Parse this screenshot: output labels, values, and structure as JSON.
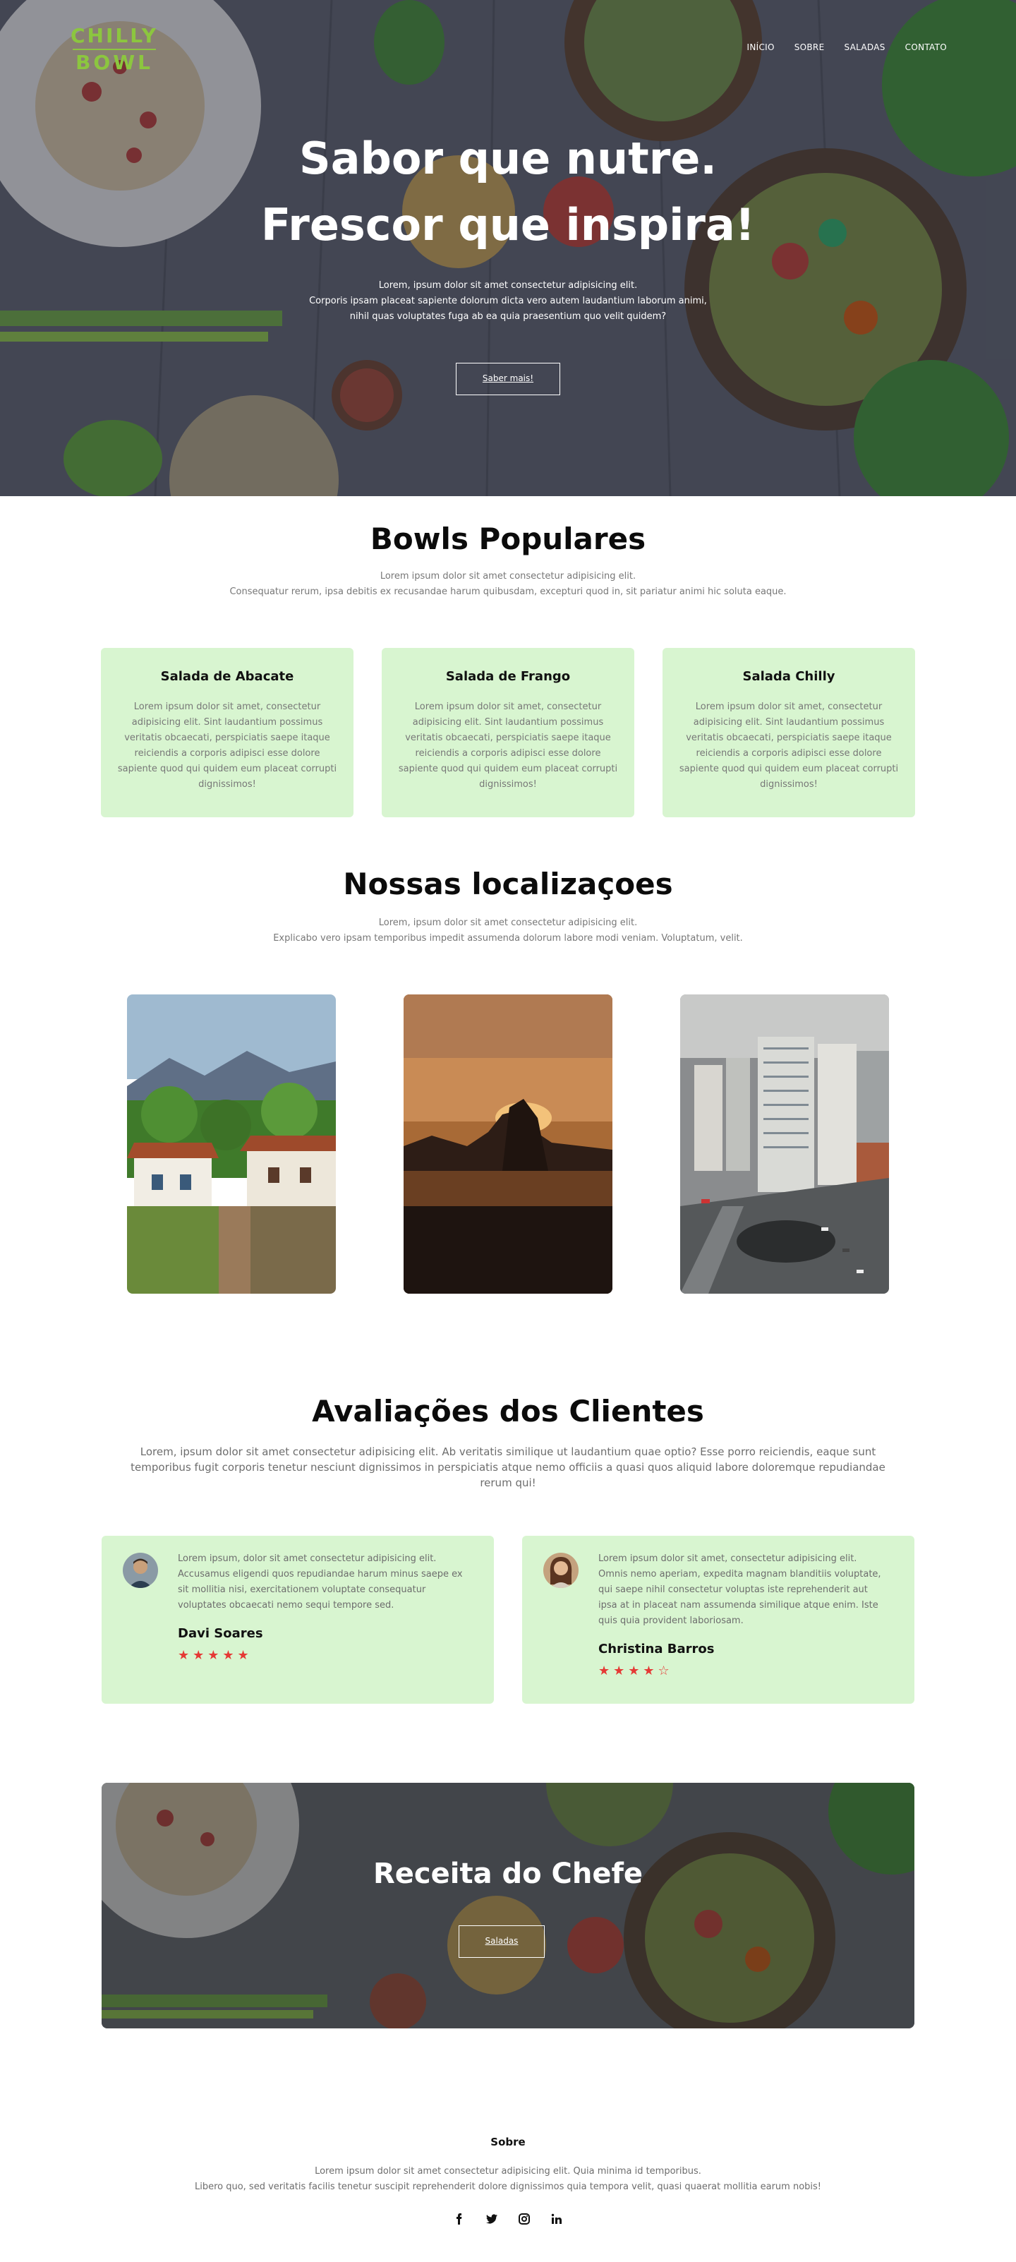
{
  "brand": {
    "line1": "CHILLY",
    "line2": "BOWL"
  },
  "nav": {
    "items": [
      "INÍCIO",
      "SOBRE",
      "SALADAS",
      "CONTATO"
    ]
  },
  "hero": {
    "title_line1": "Sabor que nutre.",
    "title_line2": "Frescor que inspira!",
    "text_line1": "Lorem, ipsum dolor sit amet consectetur adipisicing elit.",
    "text_line2": "Corporis ipsam placeat sapiente dolorum dicta vero autem laudantium laborum animi,",
    "text_line3": "nihil quas voluptates fuga ab ea quia praesentium quo velit quidem?",
    "button": "Saber mais!"
  },
  "popular": {
    "title": "Bowls Populares",
    "sub_line1": "Lorem ipsum dolor sit amet consectetur adipisicing elit.",
    "sub_line2": "Consequatur rerum, ipsa debitis ex recusandae harum quibusdam, excepturi quod in, sit pariatur animi hic soluta eaque.",
    "cards": [
      {
        "title": "Salada de Abacate",
        "text": "Lorem ipsum dolor sit amet, consectetur adipisicing elit. Sint laudantium possimus veritatis obcaecati, perspiciatis saepe itaque reiciendis a corporis adipisci esse dolore sapiente quod qui quidem eum placeat corrupti dignissimos!"
      },
      {
        "title": "Salada de Frango",
        "text": "Lorem ipsum dolor sit amet, consectetur adipisicing elit. Sint laudantium possimus veritatis obcaecati, perspiciatis saepe itaque reiciendis a corporis adipisci esse dolore sapiente quod qui quidem eum placeat corrupti dignissimos!"
      },
      {
        "title": "Salada Chilly",
        "text": "Lorem ipsum dolor sit amet, consectetur adipisicing elit. Sint laudantium possimus veritatis obcaecati, perspiciatis saepe itaque reiciendis a corporis adipisci esse dolore sapiente quod qui quidem eum placeat corrupti dignissimos!"
      }
    ]
  },
  "locations": {
    "title": "Nossas localizaçoes",
    "sub_line1": "Lorem, ipsum dolor sit amet consectetur adipisicing elit.",
    "sub_line2": "Explicabo vero ipsam temporibus impedit assumenda dolorum labore modi veniam. Voluptatum, velit."
  },
  "reviews": {
    "title": "Avaliações dos Clientes",
    "sub": "Lorem, ipsum dolor sit amet consectetur adipisicing elit. Ab veritatis similique ut laudantium quae optio? Esse porro reiciendis, eaque sunt temporibus fugit corporis tenetur nesciunt dignissimos in perspiciatis atque nemo officiis a quasi quos aliquid labore doloremque repudiandae rerum qui!",
    "items": [
      {
        "text": "Lorem ipsum, dolor sit amet consectetur adipisicing elit. Accusamus eligendi quos repudiandae harum minus saepe ex sit mollitia nisi, exercitationem voluptate consequatur voluptates obcaecati nemo sequi tempore sed.",
        "name": "Davi Soares",
        "rating": 5,
        "stars": "★★★★★"
      },
      {
        "text": "Lorem ipsum dolor sit amet, consectetur adipisicing elit. Omnis nemo aperiam, expedita magnam blanditiis voluptate, qui saepe nihil consectetur voluptas iste reprehenderit aut ipsa at in placeat nam assumenda similique atque enim. Iste quis quia provident laboriosam.",
        "name": "Christina Barros",
        "rating": 4,
        "stars": "★★★★☆"
      }
    ],
    "star_color": "#e53935"
  },
  "chef": {
    "title": "Receita do Chefe",
    "button": "Saladas"
  },
  "footer": {
    "title": "Sobre",
    "text_line1": "Lorem ipsum dolor sit amet consectetur adipisicing elit. Quia minima id temporibus.",
    "text_line2": "Libero quo, sed veritatis facilis tenetur suscipit reprehenderit dolore dignissimos quia tempora velit, quasi quaerat mollitia earum nobis!",
    "social": [
      "facebook-icon",
      "twitter-icon",
      "instagram-icon",
      "linkedin-icon"
    ]
  },
  "colors": {
    "accent": "#8cc63f",
    "card_bg": "#d8f5d0"
  }
}
